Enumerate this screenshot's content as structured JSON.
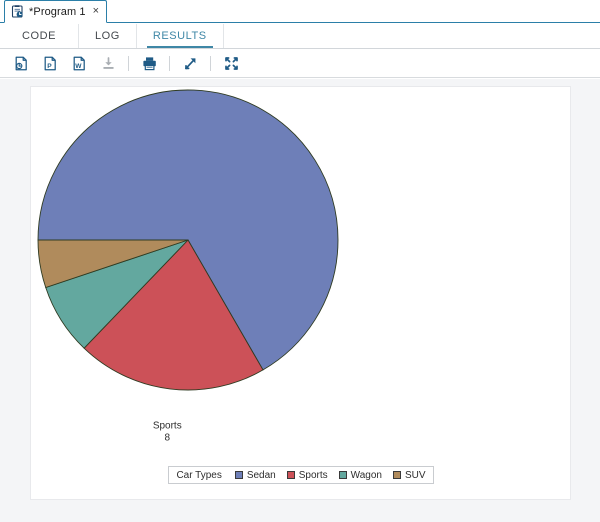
{
  "window": {
    "tab_label": "*Program 1",
    "tab_close": "×",
    "icon": "program-icon"
  },
  "section_tabs": [
    {
      "label": "CODE",
      "active": false
    },
    {
      "label": "LOG",
      "active": false
    },
    {
      "label": "RESULTS",
      "active": true
    }
  ],
  "toolbar": {
    "buttons": [
      {
        "name": "save-as-html-icon",
        "title": "HTML",
        "enabled": true
      },
      {
        "name": "save-as-pdf-icon",
        "title": "PDF",
        "enabled": true
      },
      {
        "name": "save-as-word-icon",
        "title": "RTF",
        "enabled": true
      },
      {
        "name": "download-icon",
        "title": "Download",
        "enabled": false
      },
      {
        "name": "print-icon",
        "title": "Print",
        "enabled": true
      },
      {
        "name": "open-in-new-window-icon",
        "title": "Open in new window",
        "enabled": true
      },
      {
        "name": "collapse-icon",
        "title": "Minimize",
        "enabled": true
      }
    ]
  },
  "chart_data": {
    "type": "pie",
    "title": "",
    "subtitle": "",
    "xlabel": "",
    "ylabel": "",
    "legend_position": "bottom",
    "legend_title": "Car Types",
    "categories": [
      "Sedan",
      "Sports",
      "Wagon",
      "SUV"
    ],
    "values": [
      26,
      8,
      3,
      2
    ],
    "total": 39,
    "colors": [
      "#6E7FB8",
      "#CC5158",
      "#63A89F",
      "#B08B5C"
    ],
    "slice_labels": [
      {
        "name": "Sedan",
        "value": "26"
      },
      {
        "name": "Sports",
        "value": "8"
      },
      {
        "name": "Wagon",
        "value": "3"
      },
      {
        "name": "SUV",
        "value": "2"
      }
    ],
    "start_angle_deg": 180,
    "direction": "clockwise",
    "grid": false
  },
  "colors": {
    "accent": "#3f87a6",
    "tab_border": "#2b7fa8",
    "toolbar_icon": "#1f5b86",
    "toolbar_icon_disabled": "#a9aeb3",
    "panel_bg": "#f4f5f7"
  }
}
